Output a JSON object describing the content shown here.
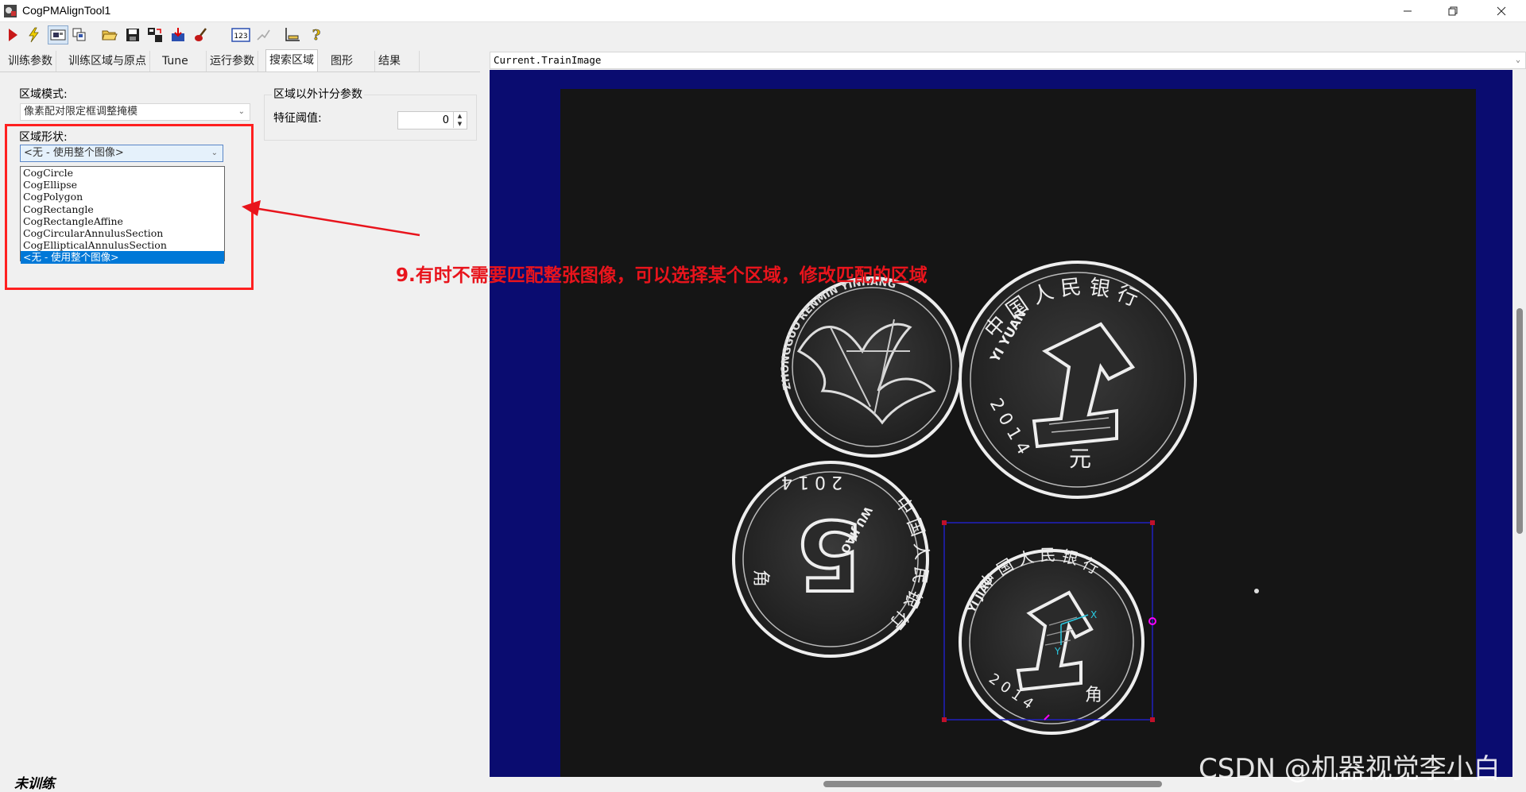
{
  "window": {
    "title": "CogPMAlignTool1",
    "minimize_icon": "minimize-icon",
    "restore_icon": "restore-icon",
    "close_icon": "close-icon"
  },
  "toolbar": {
    "buttons": [
      "run-icon",
      "lightning-icon",
      "image-icon",
      "copy-icon",
      "open-folder-icon",
      "save-icon",
      "export-icon",
      "load-icon",
      "brush-icon",
      "number-123-icon",
      "edit-disabled-icon",
      "ruler-icon",
      "help-icon"
    ],
    "number_label": "123"
  },
  "tabs": [
    "训练参数",
    "训练区域与原点",
    "Tune",
    "运行参数",
    "搜索区域",
    "图形",
    "结果"
  ],
  "active_tab": "搜索区域",
  "search_region": {
    "mode_label": "区域模式:",
    "mode_value": "像素配对限定框调整掩模",
    "shape_label": "区域形状:",
    "shape_value": "<无 - 使用整个图像>",
    "shape_options": [
      "CogCircle",
      "CogEllipse",
      "CogPolygon",
      "CogRectangle",
      "CogRectangleAffine",
      "CogCircularAnnulusSection",
      "CogEllipticalAnnulusSection",
      "<无 - 使用整个图像>"
    ],
    "outside_group_label": "区域以外计分参数",
    "threshold_label": "特征阈值:",
    "threshold_value": "0"
  },
  "status": "未训练",
  "image_view": {
    "title": "Current.TrainImage",
    "coin_1yuan_big": {
      "top": "中 国 人 民 银 行",
      "left": "YI YUAN",
      "numeral": "1",
      "year": "2 0 1 4",
      "unit": "元"
    },
    "coin_flower": {
      "ring": "ZHONGGUO RENMIN YINHANG"
    },
    "coin_5jiao": {
      "numeral": "5",
      "left": "WU JIAO",
      "year": "2 0 1 4",
      "ring": "中 国 人 民 银 行",
      "unit": "角"
    },
    "coin_1jiao": {
      "numeral": "1",
      "left": "YI JIAO",
      "year": "2 0 1 4",
      "ring": "中 国 人 民 银 行",
      "unit": "角"
    },
    "axis_x": "X",
    "axis_y": "Y"
  },
  "annotation": "9.有时不需要匹配整张图像，可以选择某个区域，修改匹配的区域",
  "watermark": "CSDN @机器视觉李小白",
  "colors": {
    "accent": "#0078d7",
    "viewer_bg": "#0a0c70",
    "annotation": "#e8141c",
    "region_box": "#2020c0",
    "handle": "#ff00ff"
  }
}
